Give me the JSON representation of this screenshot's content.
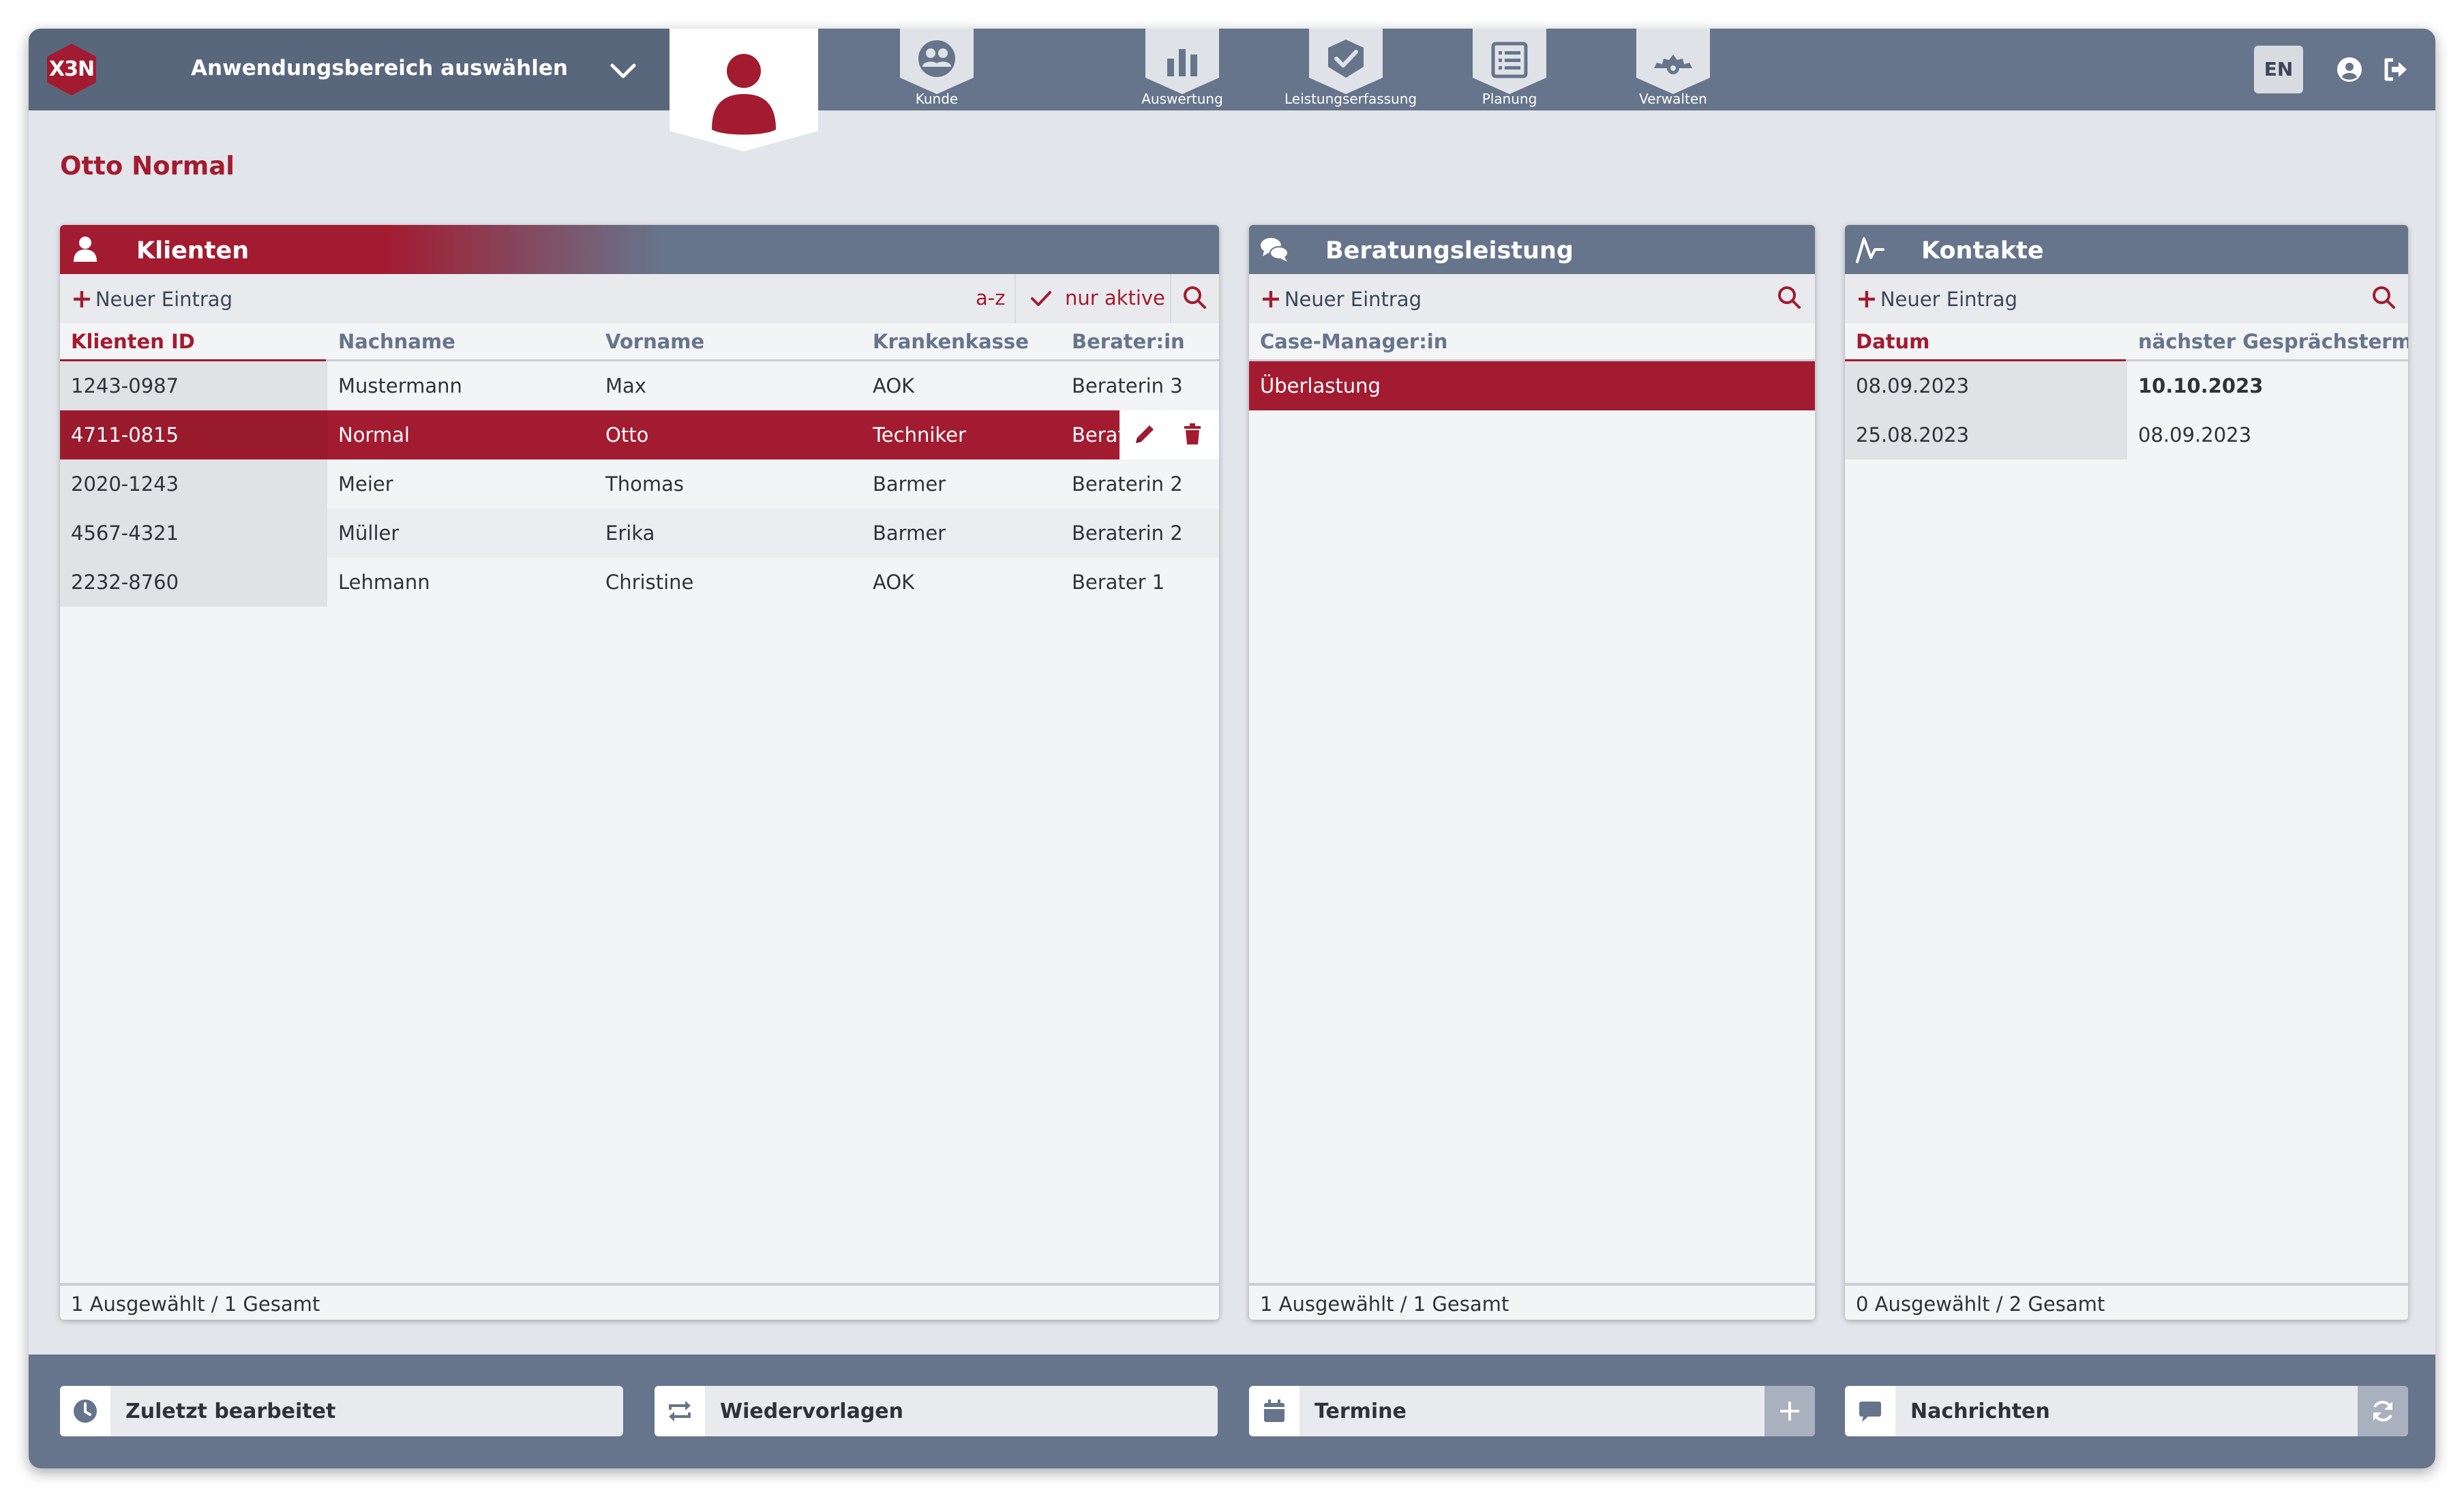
{
  "colors": {
    "accent": "#a31b30",
    "slate": "#66758c",
    "slate_dark": "#59677d",
    "panel_bg": "#f3f4f6",
    "page_bg": "#e2e5ea"
  },
  "logo_text": "X3N",
  "app_selector": {
    "label": "Anwendungsbereich auswählen",
    "icon": "chevron-down-icon"
  },
  "nav": [
    {
      "label": "Kunde",
      "icon": "group-icon"
    },
    {
      "label": "Auswertung",
      "icon": "bar-chart-icon"
    },
    {
      "label": "Leistungserfassung",
      "icon": "check-badge-icon"
    },
    {
      "label": "Planung",
      "icon": "list-icon"
    },
    {
      "label": "Verwalten",
      "icon": "gear-icon"
    }
  ],
  "language_button": "EN",
  "page_title": "Otto Normal",
  "panels": {
    "clients": {
      "title": "Klienten",
      "icon": "person-icon",
      "new_entry": "Neuer Eintrag",
      "sort_label": "a-z",
      "filter_label": "nur aktive",
      "columns": [
        "Klienten ID",
        "Nachname",
        "Vorname",
        "Krankenkasse",
        "Berater:in"
      ],
      "rows": [
        [
          "1243-0987",
          "Mustermann",
          "Max",
          "AOK",
          "Beraterin 3"
        ],
        [
          "4711-0815",
          "Normal",
          "Otto",
          "Techniker",
          "Berat"
        ],
        [
          "2020-1243",
          "Meier",
          "Thomas",
          "Barmer",
          "Beraterin 2"
        ],
        [
          "4567-4321",
          "Müller",
          "Erika",
          "Barmer",
          "Beraterin 2"
        ],
        [
          "2232-8760",
          "Lehmann",
          "Christine",
          "AOK",
          "Berater 1"
        ]
      ],
      "selected_row": 1,
      "footer": "1 Ausgewählt / 1 Gesamt"
    },
    "consulting": {
      "title": "Beratungsleistung",
      "icon": "chat-icon",
      "new_entry": "Neuer Eintrag",
      "columns": [
        "Case-Manager:in"
      ],
      "rows": [
        [
          "Überlastung"
        ]
      ],
      "selected_row": 0,
      "footer": "1 Ausgewählt / 1 Gesamt"
    },
    "contacts": {
      "title": "Kontakte",
      "icon": "activity-icon",
      "new_entry": "Neuer Eintrag",
      "columns": [
        "Datum",
        "nächster Gesprächstermin"
      ],
      "rows": [
        [
          "08.09.2023",
          "10.10.2023"
        ],
        [
          "25.08.2023",
          "08.09.2023"
        ]
      ],
      "footer": "0 Ausgewählt / 2 Gesamt"
    }
  },
  "dock": {
    "recent": "Zuletzt bearbeitet",
    "resubmissions": "Wiedervorlagen",
    "appointments": "Termine",
    "messages": "Nachrichten"
  }
}
